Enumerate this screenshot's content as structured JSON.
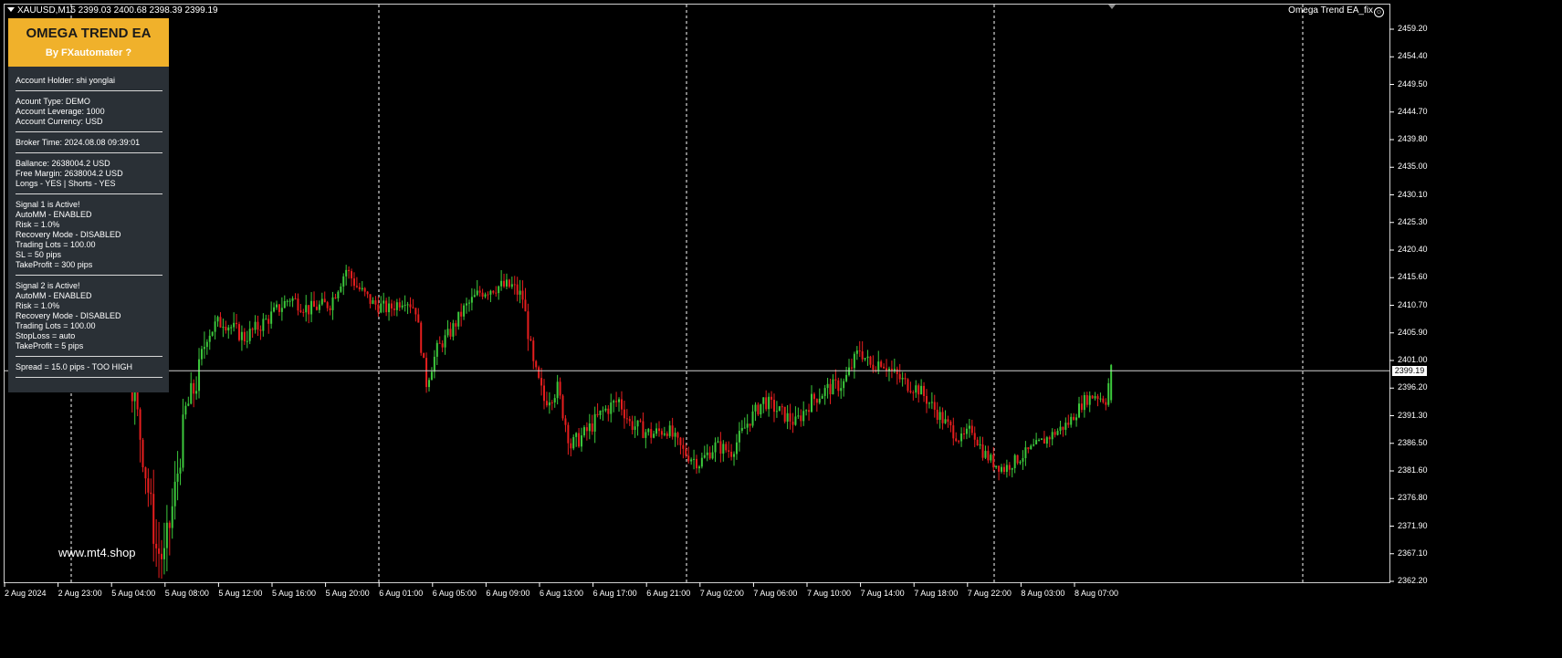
{
  "window": {
    "symbol_title": "XAUUSD,M15 2399.03 2400.68 2398.39 2399.19",
    "ea_label": "Omega Trend EA_fix",
    "smiley_glyph": "☺"
  },
  "panel": {
    "title": "OMEGA TREND EA",
    "subtitle": "By FXautomater ?",
    "header_color": "#f0b12b",
    "sections": [
      [
        "Account Holder: shi yonglai"
      ],
      [
        "Acount Type:  DEMO",
        "Account Leverage: 1000",
        "Account Currency: USD"
      ],
      [
        "Broker Time: 2024.08.08 09:39:01"
      ],
      [
        "Ballance: 2638004.2 USD",
        "Free Margin: 2638004.2 USD",
        "Longs - YES  |  Shorts - YES"
      ],
      [
        "Signal 1 is Active!",
        "AutoMM - ENABLED",
        "Risk = 1.0%",
        "Recovery Mode - DISABLED",
        "Trading Lots = 100.00",
        "SL = 50 pips",
        "TakeProfit = 300 pips"
      ],
      [
        "Signal 2 is Active!",
        "AutoMM - ENABLED",
        "Risk = 1.0%",
        "Recovery Mode - DISABLED",
        "Trading Lots = 100.00",
        "StopLoss = auto",
        "TakeProfit = 5 pips"
      ],
      [
        "Spread = 15.0 pips - TOO HIGH"
      ]
    ]
  },
  "watermark": "www.mt4.shop",
  "price_axis": {
    "ticks": [
      "2459.20",
      "2454.40",
      "2449.50",
      "2444.70",
      "2439.80",
      "2435.00",
      "2430.10",
      "2425.30",
      "2420.40",
      "2415.60",
      "2410.70",
      "2405.90",
      "2401.00",
      "2396.20",
      "2391.30",
      "2386.50",
      "2381.60",
      "2376.80",
      "2371.90",
      "2367.10",
      "2362.20"
    ],
    "current_price": "2399.19"
  },
  "time_axis": {
    "labels": [
      "2 Aug 2024",
      "2 Aug 23:00",
      "5 Aug 04:00",
      "5 Aug 08:00",
      "5 Aug 12:00",
      "5 Aug 16:00",
      "5 Aug 20:00",
      "6 Aug 01:00",
      "6 Aug 05:00",
      "6 Aug 09:00",
      "6 Aug 13:00",
      "6 Aug 17:00",
      "6 Aug 21:00",
      "7 Aug 02:00",
      "7 Aug 06:00",
      "7 Aug 10:00",
      "7 Aug 14:00",
      "7 Aug 18:00",
      "7 Aug 22:00",
      "8 Aug 03:00",
      "8 Aug 07:00"
    ]
  },
  "chart_data": {
    "type": "candlestick",
    "symbol": "XAUUSD",
    "timeframe": "M15",
    "ylim": [
      2362.2,
      2459.2
    ],
    "bull_color": "#3cc83c",
    "bear_color": "#e61e1e",
    "grid_color": "#ffffff",
    "close_path": [
      [
        0,
        2438
      ],
      [
        6,
        2436
      ],
      [
        12,
        2440
      ],
      [
        17,
        2433
      ],
      [
        22,
        2437
      ],
      [
        26,
        2428
      ],
      [
        30,
        2430
      ],
      [
        35,
        2425
      ],
      [
        40,
        2418
      ],
      [
        45,
        2400
      ],
      [
        50,
        2385
      ],
      [
        55,
        2368
      ],
      [
        58,
        2366
      ],
      [
        62,
        2378
      ],
      [
        66,
        2392
      ],
      [
        70,
        2397
      ],
      [
        74,
        2406
      ],
      [
        80,
        2408
      ],
      [
        88,
        2405
      ],
      [
        96,
        2408
      ],
      [
        105,
        2412
      ],
      [
        112,
        2410
      ],
      [
        120,
        2411
      ],
      [
        126,
        2417
      ],
      [
        130,
        2414
      ],
      [
        136,
        2411
      ],
      [
        142,
        2410
      ],
      [
        148,
        2412
      ],
      [
        152,
        2410
      ],
      [
        156,
        2397
      ],
      [
        160,
        2403
      ],
      [
        165,
        2406
      ],
      [
        170,
        2410
      ],
      [
        176,
        2413
      ],
      [
        182,
        2414
      ],
      [
        188,
        2414
      ],
      [
        192,
        2412
      ],
      [
        196,
        2400
      ],
      [
        200,
        2394
      ],
      [
        205,
        2396
      ],
      [
        210,
        2386
      ],
      [
        215,
        2388
      ],
      [
        222,
        2392
      ],
      [
        228,
        2394
      ],
      [
        232,
        2390
      ],
      [
        240,
        2388
      ],
      [
        246,
        2389
      ],
      [
        252,
        2385
      ],
      [
        258,
        2383
      ],
      [
        264,
        2386
      ],
      [
        270,
        2385
      ],
      [
        276,
        2390
      ],
      [
        282,
        2394
      ],
      [
        288,
        2392
      ],
      [
        294,
        2390
      ],
      [
        300,
        2394
      ],
      [
        306,
        2396
      ],
      [
        312,
        2397
      ],
      [
        318,
        2403
      ],
      [
        322,
        2400
      ],
      [
        326,
        2401
      ],
      [
        330,
        2399
      ],
      [
        335,
        2397
      ],
      [
        340,
        2396
      ],
      [
        345,
        2393
      ],
      [
        350,
        2390
      ],
      [
        356,
        2387
      ],
      [
        360,
        2389
      ],
      [
        364,
        2385
      ],
      [
        368,
        2383
      ],
      [
        372,
        2382
      ],
      [
        378,
        2384
      ],
      [
        384,
        2386
      ],
      [
        390,
        2388
      ],
      [
        396,
        2390
      ],
      [
        402,
        2394
      ],
      [
        406,
        2395
      ],
      [
        410,
        2394
      ],
      [
        412,
        2400
      ]
    ],
    "volatility": [
      [
        0,
        2.4
      ],
      [
        60,
        4.5
      ],
      [
        80,
        1.8
      ],
      [
        160,
        1.5
      ],
      [
        200,
        2.0
      ],
      [
        260,
        1.6
      ],
      [
        320,
        1.8
      ],
      [
        370,
        1.4
      ],
      [
        412,
        1.3
      ]
    ],
    "last_candle": {
      "open": 2399.03,
      "high": 2400.68,
      "low": 2398.39,
      "close": 2399.19
    }
  }
}
